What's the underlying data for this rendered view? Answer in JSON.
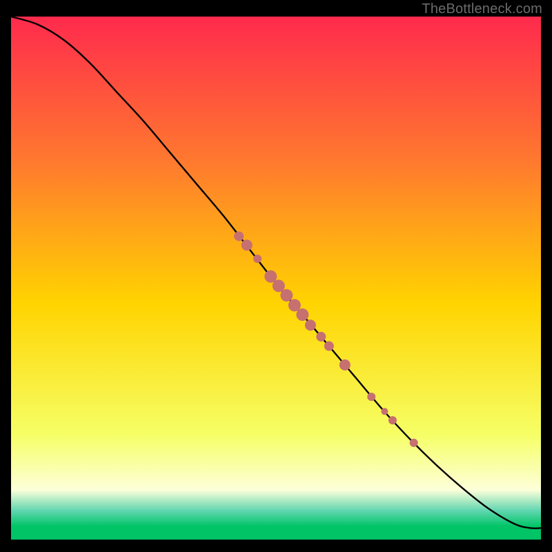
{
  "attribution": "TheBottleneck.com",
  "colors": {
    "top": "#ff2a4d",
    "mid_upper": "#ff7a2e",
    "mid": "#ffd400",
    "mid_lower": "#f6ff66",
    "lower_pale": "#fdffd9",
    "teal": "#5fd6b0",
    "green": "#00c465",
    "curve": "#000000",
    "marker": "#c67070",
    "marker_stroke": "#b55f5f"
  },
  "gradient_stops": [
    {
      "offset": 0.0,
      "key": "top"
    },
    {
      "offset": 0.28,
      "key": "mid_upper"
    },
    {
      "offset": 0.55,
      "key": "mid"
    },
    {
      "offset": 0.8,
      "key": "mid_lower"
    },
    {
      "offset": 0.905,
      "key": "lower_pale"
    },
    {
      "offset": 0.945,
      "key": "teal"
    },
    {
      "offset": 0.975,
      "key": "green"
    },
    {
      "offset": 1.0,
      "key": "green"
    }
  ],
  "chart_data": {
    "type": "line",
    "title": "",
    "xlabel": "",
    "ylabel": "",
    "xlim": [
      0,
      100
    ],
    "ylim": [
      0,
      100
    ],
    "series": [
      {
        "name": "curve",
        "x": [
          0,
          5,
          10,
          15,
          20,
          25,
          30,
          35,
          40,
          45,
          50,
          55,
          60,
          65,
          70,
          75,
          80,
          85,
          90,
          95,
          98,
          100
        ],
        "y": [
          100,
          98.5,
          95.5,
          91,
          85.5,
          80,
          74,
          68,
          62,
          55.5,
          49,
          43,
          37,
          31,
          25,
          19.5,
          14.5,
          10,
          6,
          3,
          2.2,
          2.2
        ]
      }
    ],
    "markers": {
      "name": "highlighted-points",
      "points": [
        {
          "x": 43.0,
          "y": 58.0,
          "r": 7
        },
        {
          "x": 44.5,
          "y": 56.3,
          "r": 8
        },
        {
          "x": 46.5,
          "y": 53.7,
          "r": 6
        },
        {
          "x": 49.0,
          "y": 50.3,
          "r": 9
        },
        {
          "x": 50.5,
          "y": 48.5,
          "r": 9
        },
        {
          "x": 52.0,
          "y": 46.7,
          "r": 9
        },
        {
          "x": 53.5,
          "y": 44.8,
          "r": 9
        },
        {
          "x": 55.0,
          "y": 43.0,
          "r": 9
        },
        {
          "x": 56.5,
          "y": 41.0,
          "r": 8
        },
        {
          "x": 58.5,
          "y": 38.8,
          "r": 7
        },
        {
          "x": 60.0,
          "y": 37.0,
          "r": 7
        },
        {
          "x": 63.0,
          "y": 33.4,
          "r": 8
        },
        {
          "x": 68.0,
          "y": 27.3,
          "r": 6
        },
        {
          "x": 70.5,
          "y": 24.5,
          "r": 5
        },
        {
          "x": 72.0,
          "y": 22.8,
          "r": 6
        },
        {
          "x": 76.0,
          "y": 18.5,
          "r": 6
        }
      ]
    }
  }
}
